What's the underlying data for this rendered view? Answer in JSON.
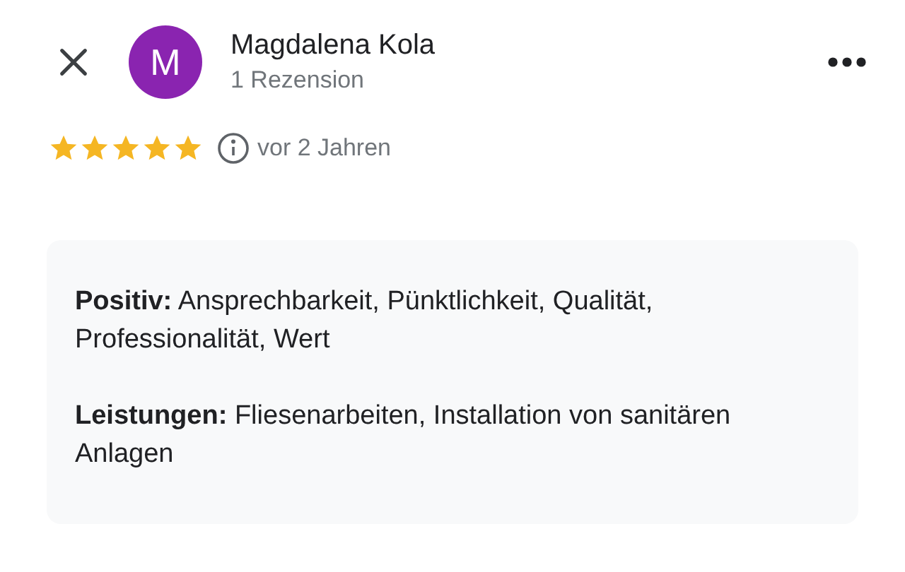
{
  "header": {
    "avatar_letter": "M",
    "name": "Magdalena Kola",
    "review_count": "1 Rezension"
  },
  "rating": {
    "stars": 5,
    "time": "vor 2 Jahren"
  },
  "details": [
    {
      "text": "**Positiv:** Ansprechbarkeit, Pünktlichkeit, Qualität, Professionalität, Wert"
    },
    {
      "text": "**Leistungen:** Fliesenarbeiten, Installation von sanitären Anlagen"
    }
  ]
}
